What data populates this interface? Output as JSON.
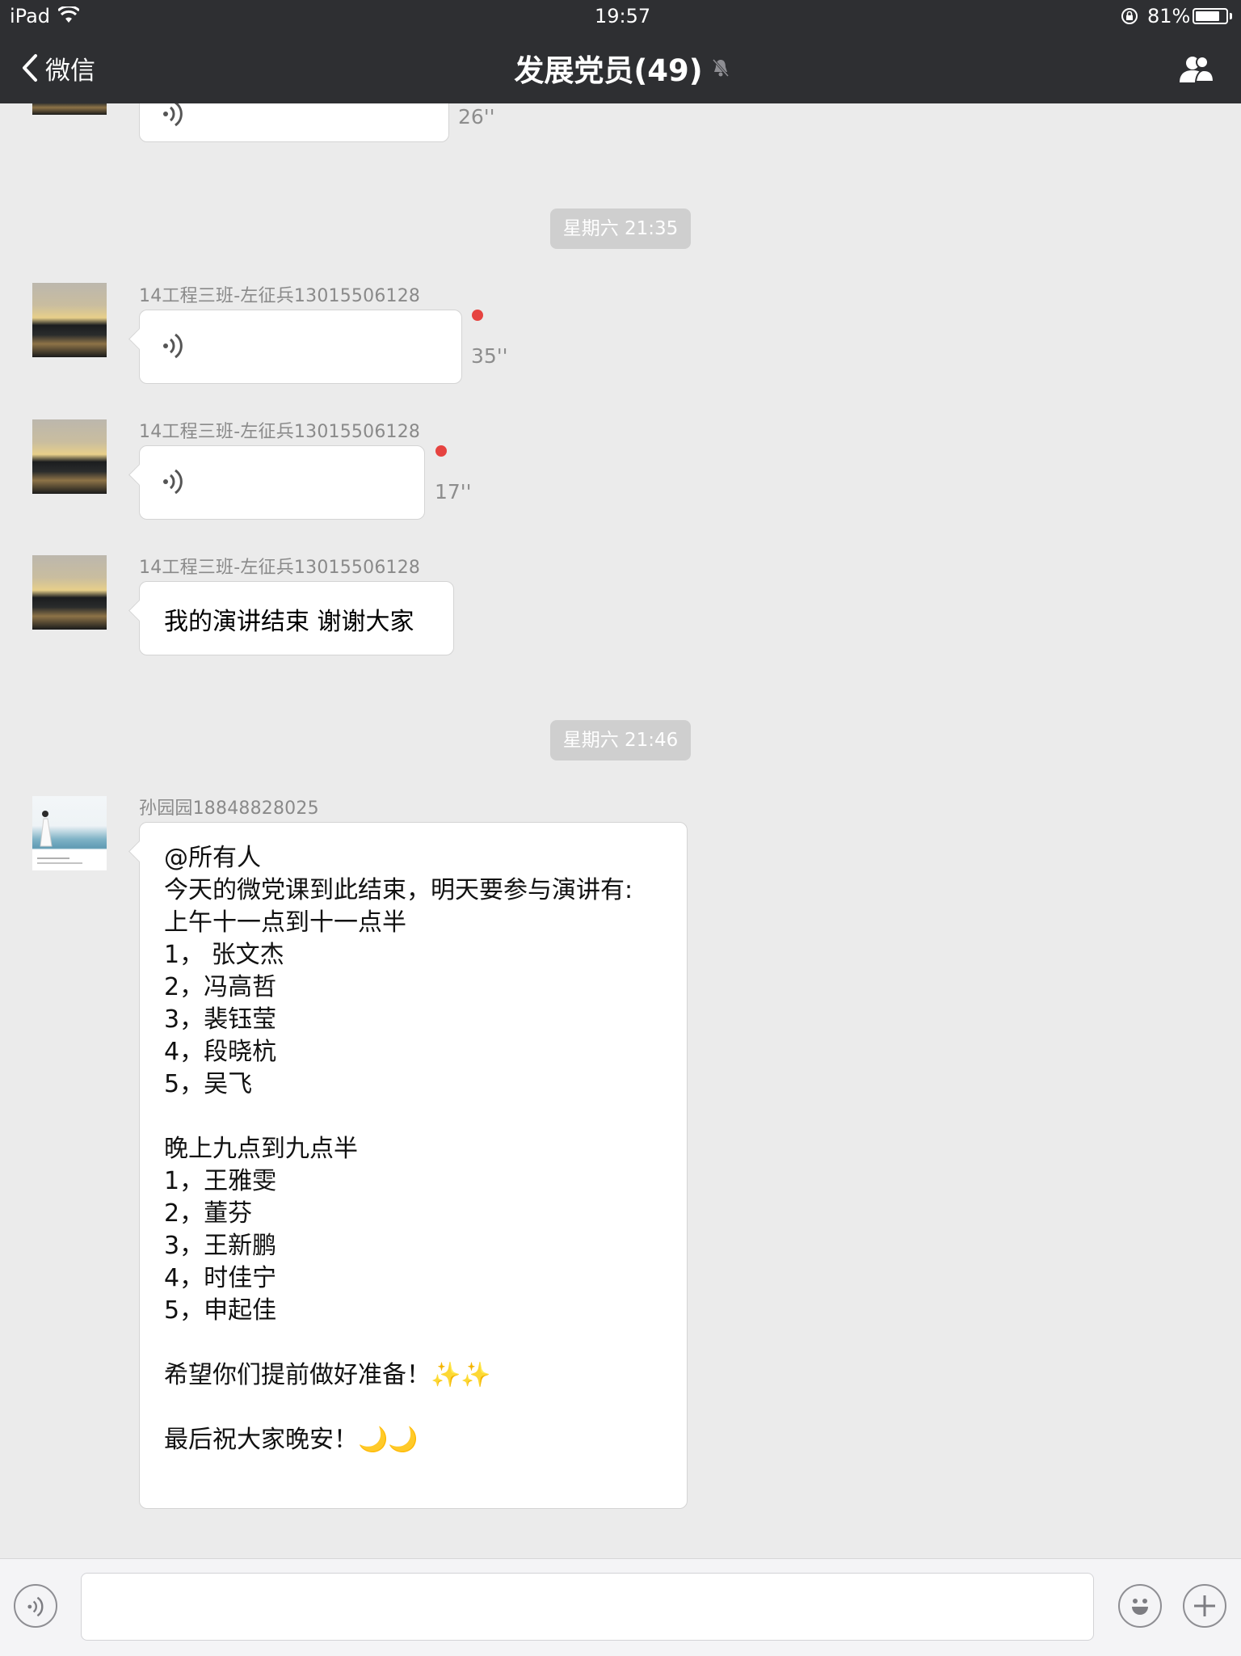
{
  "status_bar": {
    "device": "iPad",
    "time": "19:57",
    "battery": "81%",
    "battery_level": 0.81
  },
  "nav": {
    "back_label": "微信",
    "title": "发展党员(49)",
    "mute_icon": "bell-slash-icon",
    "members_icon": "group-icon"
  },
  "messages": {
    "top_partial": {
      "duration": "26''"
    },
    "timestamp_1": "星期六 21:35",
    "voice_1": {
      "sender": "14工程三班-左征兵13015506128",
      "duration": "35''",
      "unread": true
    },
    "voice_2": {
      "sender": "14工程三班-左征兵13015506128",
      "duration": "17''",
      "unread": true
    },
    "text_1": {
      "sender": "14工程三班-左征兵13015506128",
      "text": "我的演讲结束 谢谢大家"
    },
    "timestamp_2": "星期六 21:46",
    "text_2": {
      "sender": "孙园园18848828025",
      "lines": [
        "@所有人",
        "今天的微党课到此结束，明天要参与演讲有:",
        "上午十一点到十一点半",
        "1， 张文杰",
        "2，冯高哲",
        "3，裴钰莹",
        "4，段晓杭",
        "5，吴飞",
        "",
        "晚上九点到九点半",
        "1，王雅雯",
        "2，董芬",
        "3，王新鹏",
        "4，时佳宁",
        "5，申起佳",
        "",
        "希望你们提前做好准备！✨✨",
        "",
        "最后祝大家晚安！🌙🌙"
      ]
    }
  },
  "input_bar": {
    "voice_button_icon": "voice-icon",
    "emoji_button_icon": "smiley-icon",
    "add_button_icon": "plus-icon",
    "placeholder": ""
  },
  "colors": {
    "bar_bg": "#2e2f32",
    "chat_bg": "#ebebeb",
    "unread_dot": "#e64340",
    "timestamp_bg": "#cfcfcf"
  }
}
